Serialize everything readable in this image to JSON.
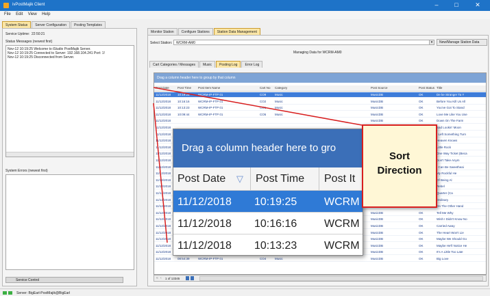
{
  "window": {
    "title": "ivPostMajik Client",
    "minimize_glyph": "–",
    "maximize_glyph": "□",
    "close_glyph": "✕"
  },
  "menu": [
    "File",
    "Edit",
    "View",
    "Help"
  ],
  "left_tabs": [
    "System Status",
    "Server Configuration",
    "Posting Templates"
  ],
  "left": {
    "uptime_label": "Service Uptime:",
    "uptime_value": "22:50:21",
    "status_messages_label": "Status Messages (newest first)",
    "status_messages": [
      "Nov-12 10:19:25 Welcome to iStudio PostMajik Server.",
      "Nov-12 10:19:25 Connected to Server: 192.168.104.241 Port: 1!",
      "Nov-12 10:19:25 Disconnected from Server."
    ],
    "system_errors_label": "System Errors (newest first)",
    "service_control_label": "Service Control"
  },
  "main_tabs": [
    "Monitor Station",
    "Configure Stations",
    "Station Data Management"
  ],
  "select_station_label": "Select Station:",
  "select_station_value": "WCRM-AM0",
  "new_manage_button": "New/Manage Station Data",
  "managing_label": "Managing Data for WCRM-AM0",
  "sub_tabs": [
    "Cart Categories / Messages",
    "Music",
    "Posting Log",
    "Error Log"
  ],
  "grid": {
    "group_hint": "Drag a column header here to group by that column",
    "columns": [
      "Post Date",
      "Post Time",
      "Post Item Name",
      "Cart No",
      "Category",
      "Post Source",
      "Post Status",
      "Title"
    ],
    "rows": [
      [
        "11/12/2018",
        "10:19:25",
        "WCRM-IP-FTP 01",
        "CO9",
        "Music",
        "MusicDB",
        "OK",
        "De ke Stranger Ta Y"
      ],
      [
        "11/12/2018",
        "10:16:16",
        "WCRM-IP-FTP 01",
        "CO2",
        "Music",
        "MusicDB",
        "OK",
        "Before You Kill Us All"
      ],
      [
        "11/12/2018",
        "10:13:23",
        "WCRM-IP-FTP 01",
        "CO1",
        "Music",
        "MusicDB",
        "OK",
        "You've Got To Stand"
      ],
      [
        "11/12/2018",
        "10:09:44",
        "WCRM-IP-FTP 01",
        "CO5",
        "Music",
        "MusicDB",
        "OK",
        "Love Me Like You Use"
      ],
      [
        "11/12/2018",
        "",
        "",
        "",
        "",
        "MusicDB",
        "OK",
        "Down On The Farm"
      ],
      [
        "11/12/2018",
        "",
        "",
        "",
        "",
        "MusicDB",
        "OK",
        "Sad Lookin' Moon"
      ],
      [
        "11/12/2018",
        "",
        "",
        "",
        "",
        "MusicDB",
        "OK",
        "I Left Something Turn"
      ],
      [
        "11/12/2018",
        "",
        "",
        "",
        "",
        "MusicDB",
        "OK",
        "Heaven Knows"
      ],
      [
        "11/12/2018",
        "",
        "",
        "",
        "",
        "MusicDB",
        "OK",
        "Little Rock"
      ],
      [
        "11/12/2018",
        "",
        "",
        "",
        "",
        "MusicDB",
        "OK",
        "One Way Ticket (Beca"
      ],
      [
        "11/12/2018",
        "",
        "",
        "",
        "",
        "MusicDB",
        "OK",
        "Don't Take Anym"
      ],
      [
        "11/12/2018",
        "",
        "",
        "",
        "",
        "MusicDB",
        "OK",
        "I Can Be Sweetheai"
      ],
      [
        "11/12/2018",
        "",
        "",
        "",
        "",
        "MusicDB",
        "OK",
        "My Rockful He"
      ],
      [
        "11/12/2018",
        "",
        "",
        "",
        "",
        "MusicDB",
        "OK",
        "Of Being Al"
      ],
      [
        "11/12/2018",
        "",
        "",
        "",
        "",
        "MusicDB",
        "OK",
        "Rebel"
      ],
      [
        "11/12/2018",
        "",
        "",
        "",
        "",
        "MusicDB",
        "OK",
        "Quarter (Ca"
      ],
      [
        "11/12/2018",
        "",
        "",
        "",
        "",
        "MusicDB",
        "OK",
        "Ordinary"
      ],
      [
        "11/12/2018",
        "",
        "",
        "",
        "",
        "MusicDB",
        "OK",
        "On The Other Hand"
      ],
      [
        "11/12/2018",
        "",
        "",
        "",
        "",
        "MusicDB",
        "OK",
        "Tell Me Why"
      ],
      [
        "11/12/2018",
        "",
        "",
        "",
        "",
        "MusicDB",
        "OK",
        "Wish I Didn't Know No"
      ],
      [
        "11/12/2018",
        "",
        "",
        "",
        "",
        "MusicDB",
        "OK",
        "Carried Away"
      ],
      [
        "11/12/2018",
        "09:07:56",
        "WCRM-IP-FTP 01",
        "CO2",
        "Music",
        "MusicDB",
        "OK",
        "The Heart Won't Lie"
      ],
      [
        "11/12/2018",
        "09:04:06",
        "WCRM-IP-FTP 01",
        "CO2",
        "Music",
        "MusicDB",
        "OK",
        "Maybe We Should Go"
      ],
      [
        "11/12/2018",
        "09:01:26",
        "WCRM-IP-FTP 01",
        "CO9",
        "Music",
        "MusicDB",
        "OK",
        "Maybe He'll Notice He"
      ],
      [
        "11/12/2018",
        "08:58:01",
        "WCRM-IP-FTP 01",
        "CO7",
        "Music",
        "MusicDB",
        "OK",
        "It's A Little Too Late"
      ],
      [
        "11/12/2018",
        "08:54:39",
        "WCRM-IP-FTP 01",
        "CO4",
        "Music",
        "MusicDB",
        "OK",
        "Big Love"
      ]
    ],
    "pager_text": "1 of 13345"
  },
  "zoom": {
    "group_hint": "Drag a column header here to gro",
    "columns": [
      "Post Date",
      "Post Time",
      "Post It"
    ],
    "sort_glyph": "▽",
    "rows": [
      [
        "11/12/2018",
        "10:19:25",
        "WCRM"
      ],
      [
        "11/12/2018",
        "10:16:16",
        "WCRM"
      ],
      [
        "11/12/2018",
        "10:13:23",
        "WCRM"
      ]
    ]
  },
  "callout": {
    "line1": "Sort",
    "line2": "Direction"
  },
  "statusbar": {
    "text": "Server: BigEarl-PostMajik@BigEarl"
  },
  "colors": {
    "title_blue": "#1e73c8",
    "tab_active": "#fbe6a6",
    "selection": "#3d7cd9",
    "callout_red": "#d81e1e"
  },
  "icons": [
    "app-icon",
    "dropdown-arrow-icon",
    "pager-first-icon",
    "pager-prev-icon",
    "pager-next-icon",
    "pager-last-icon"
  ]
}
